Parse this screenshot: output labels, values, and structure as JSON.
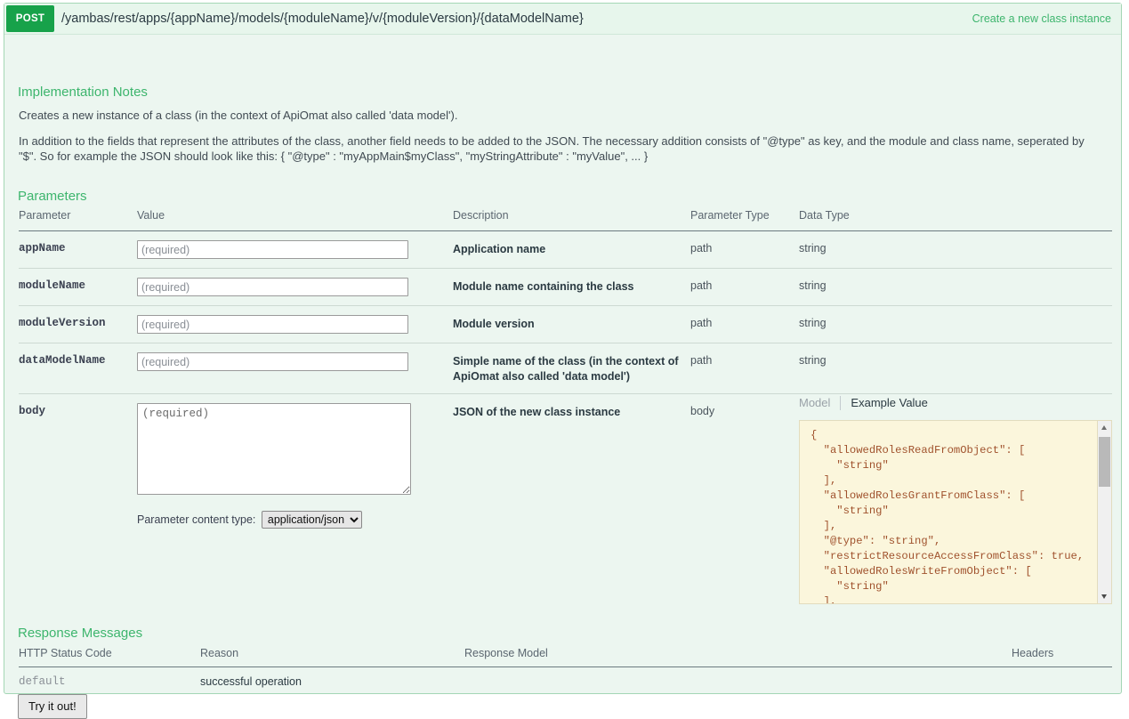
{
  "operation": {
    "method": "POST",
    "path": "/yambas/rest/apps/{appName}/models/{moduleName}/v/{moduleVersion}/{dataModelName}",
    "summary": "Create a new class instance"
  },
  "notes": {
    "title": "Implementation Notes",
    "paragraph1": "Creates a new instance of a class (in the context of ApiOmat also called 'data model').",
    "paragraph2": "In addition to the fields that represent the attributes of the class, another field needs to be added to the JSON. The necessary addition consists of \"@type\" as key, and the module and class name, seperated by \"$\". So for example the JSON should look like this: { \"@type\" : \"myAppMain$myClass\", \"myStringAttribute\" : \"myValue\", ... }"
  },
  "parameters": {
    "title": "Parameters",
    "headers": {
      "parameter": "Parameter",
      "value": "Value",
      "description": "Description",
      "parameter_type": "Parameter Type",
      "data_type": "Data Type"
    },
    "rows": [
      {
        "name": "appName",
        "placeholder": "(required)",
        "description": "Application name",
        "parameter_type": "path",
        "data_type": "string",
        "value": ""
      },
      {
        "name": "moduleName",
        "placeholder": "(required)",
        "description": "Module name containing the class",
        "parameter_type": "path",
        "data_type": "string",
        "value": ""
      },
      {
        "name": "moduleVersion",
        "placeholder": "(required)",
        "description": "Module version",
        "parameter_type": "path",
        "data_type": "string",
        "value": ""
      },
      {
        "name": "dataModelName",
        "placeholder": "(required)",
        "description": "Simple name of the class (in the context of ApiOmat also called 'data model')",
        "parameter_type": "path",
        "data_type": "string",
        "value": ""
      },
      {
        "name": "body",
        "placeholder": "(required)",
        "description": "JSON of the new class instance",
        "parameter_type": "body",
        "data_type": "",
        "value": ""
      }
    ],
    "content_type_label": "Parameter content type:",
    "content_type_value": "application/json",
    "content_type_options": [
      "application/json"
    ]
  },
  "signature": {
    "tab_model": "Model",
    "tab_example": "Example Value",
    "active_tab": "Example Value",
    "example_json": "{\n  \"allowedRolesReadFromObject\": [\n    \"string\"\n  ],\n  \"allowedRolesGrantFromClass\": [\n    \"string\"\n  ],\n  \"@type\": \"string\",\n  \"restrictResourceAccessFromClass\": true,\n  \"allowedRolesWriteFromObject\": [\n    \"string\"\n  ],"
  },
  "responses": {
    "title": "Response Messages",
    "headers": {
      "status_code": "HTTP Status Code",
      "reason": "Reason",
      "response_model": "Response Model",
      "headers": "Headers"
    },
    "rows": [
      {
        "status_code": "default",
        "reason": "successful operation",
        "response_model": "",
        "headers": ""
      }
    ]
  },
  "actions": {
    "try_it_out": "Try it out!"
  },
  "colors": {
    "method_post": "#17a24a",
    "accent_green": "#3db56d",
    "panel_bg": "#ecf6f0",
    "panel_border": "#a4d7b5",
    "example_bg": "#fbf6dc",
    "json_string": "#a0522d"
  }
}
